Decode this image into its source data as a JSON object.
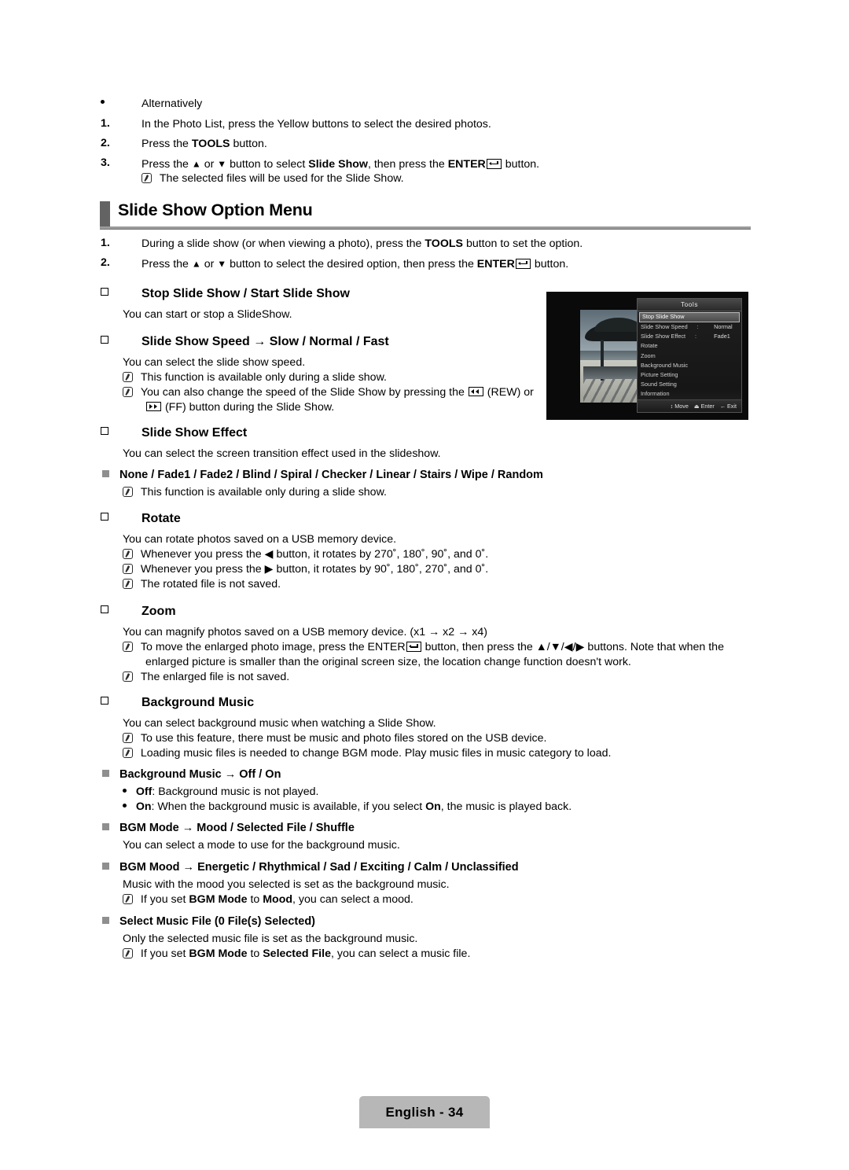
{
  "intro": {
    "alternatively": "Alternatively",
    "steps": [
      {
        "num": "1.",
        "text": "In the Photo List, press the Yellow buttons to select the desired photos."
      },
      {
        "num": "2.",
        "text": "Press the TOOLS button."
      },
      {
        "num": "3.",
        "text": "Press the ▲ or ▼ button to select Slide Show, then press the ENTER button."
      }
    ],
    "step3_note": "The selected files will be used for the Slide Show."
  },
  "heading": "Slide Show Option Menu",
  "menu_steps": [
    {
      "num": "1.",
      "text": "During a slide show (or when viewing a photo), press the TOOLS button to set the option."
    },
    {
      "num": "2.",
      "text": "Press the ▲ or ▼ button to select the desired option, then press the ENTER button."
    }
  ],
  "sections": {
    "stop_start": {
      "title": "Stop Slide Show / Start Slide Show",
      "body": "You can start or stop a SlideShow."
    },
    "speed": {
      "title": "Slide Show Speed → Slow / Normal / Fast",
      "body": "You can select the slide show speed.",
      "notes": [
        "This function is available only during a slide show.",
        "You can also change the speed of the Slide Show by pressing the  (REW) or  (FF) button during the Slide Show."
      ]
    },
    "effect": {
      "title": "Slide Show Effect",
      "body": "You can select the screen transition effect used in the slideshow.",
      "sub_title": "None / Fade1 / Fade2 / Blind / Spiral / Checker / Linear / Stairs / Wipe / Random",
      "sub_note": "This function is available only during a slide show."
    },
    "rotate": {
      "title": "Rotate",
      "body": "You can rotate photos saved on a USB memory device.",
      "notes": [
        "Whenever you press the ◀ button, it rotates by 270˚, 180˚, 90˚, and 0˚.",
        "Whenever you press the ▶ button, it rotates by 90˚, 180˚, 270˚, and 0˚.",
        "The rotated file is not saved."
      ]
    },
    "zoom": {
      "title": "Zoom",
      "body": "You can magnify photos saved on a USB memory device. (x1 → x2 → x4)",
      "note1_a": "To move the enlarged photo image, press the ENTER",
      "note1_b": " button, then press the ▲/▼/◀/▶ buttons. Note that when the",
      "note1_c": "enlarged picture is smaller than the original screen size, the location change function doesn't work.",
      "note2": "The enlarged file is not saved."
    },
    "bgm": {
      "title": "Background Music",
      "body": "You can select background music when watching a Slide Show.",
      "notes": [
        "To use this feature, there must be music and photo files stored on the USB device.",
        "Loading music files is needed to change BGM mode. Play music files in music category to load."
      ],
      "bgm_toggle_title": "Background Music → Off / On",
      "bgm_off": "Off: Background music is not played.",
      "bgm_on": "On: When the background music is available, if you select On, the music is played back.",
      "mode_title": "BGM Mode → Mood / Selected File / Shuffle",
      "mode_body": "You can select a mode to use for the background music.",
      "mood_title": "BGM Mood → Energetic / Rhythmical / Sad / Exciting / Calm / Unclassified",
      "mood_body": "Music with the mood you selected is set as the background music.",
      "mood_note": "If you set BGM Mode to Mood, you can select a mood.",
      "file_title": "Select Music File (0 File(s) Selected)",
      "file_body": "Only the selected music file is set as the background music.",
      "file_note": "If you set BGM Mode to Selected File, you can select a music file."
    }
  },
  "tv": {
    "menu_title": "Tools",
    "items": [
      {
        "label": "Stop Slide Show",
        "colon": "",
        "value": "",
        "selected": true
      },
      {
        "label": "Slide Show Speed",
        "colon": ":",
        "value": "Normal",
        "selected": false
      },
      {
        "label": "Slide Show Effect",
        "colon": ":",
        "value": "Fade1",
        "selected": false
      },
      {
        "label": "Rotate",
        "colon": "",
        "value": "",
        "selected": false
      },
      {
        "label": "Zoom",
        "colon": "",
        "value": "",
        "selected": false
      },
      {
        "label": "Background Music",
        "colon": "",
        "value": "",
        "selected": false
      },
      {
        "label": "Picture Setting",
        "colon": "",
        "value": "",
        "selected": false
      },
      {
        "label": "Sound Setting",
        "colon": "",
        "value": "",
        "selected": false
      },
      {
        "label": "Information",
        "colon": "",
        "value": "",
        "selected": false
      }
    ],
    "more_indicator": "▼",
    "footer": {
      "move": "Move",
      "enter": "Enter",
      "exit": "Exit"
    }
  },
  "footer": {
    "page_label": "English - 34"
  },
  "colors": {
    "heading_bar": "#636363",
    "heading_rule": "#9b9b9b",
    "bullet_grey": "#8f8f8f",
    "page_badge": "#b7b7b7"
  }
}
